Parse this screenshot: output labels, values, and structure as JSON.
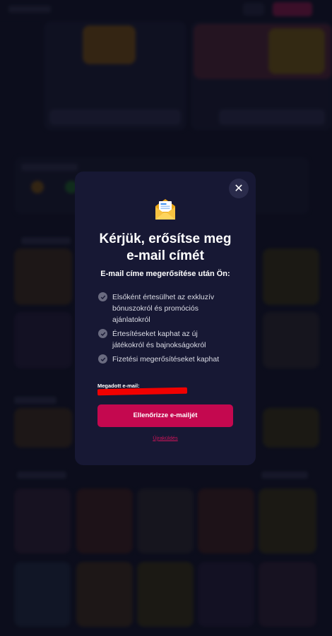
{
  "modal": {
    "title_line1": "Kérjük, erősítse meg",
    "title_line2": "e-mail címét",
    "subtitle": "E-mail címe megerősítése után Ön:",
    "benefits": [
      {
        "line1": "Elsőként értesülhet az exkluzív",
        "line2": "bónuszokról és promóciós",
        "line3": "ajánlatokról"
      },
      {
        "line1": "Értesítéseket kaphat az új",
        "line2": "játékokról és bajnokságokról"
      },
      {
        "line1": "Fizetési megerősítéseket kaphat"
      }
    ],
    "email_label": "Megadott e-mail:",
    "verify_button": "Ellenőrizze e-mailjét",
    "resend_link": "Újraküldés",
    "close_symbol": "✕",
    "icons": {
      "close": "close-icon",
      "envelope": "envelope-icon",
      "check": "check-circle-icon"
    }
  },
  "colors": {
    "modal_bg": "#171834",
    "page_bg": "#14152a",
    "accent": "#c4084f",
    "link": "#d0145a",
    "redaction": "#f10000"
  }
}
